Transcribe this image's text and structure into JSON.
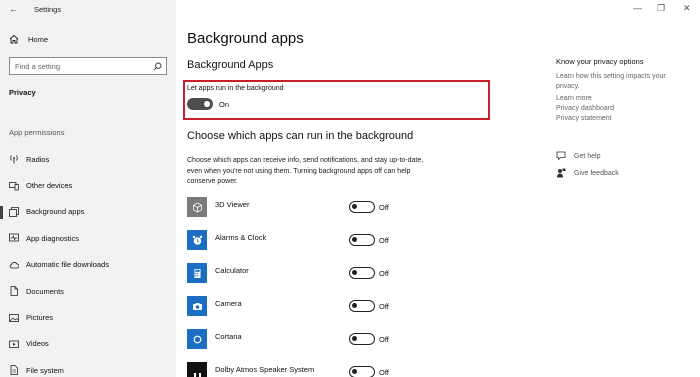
{
  "window": {
    "title": "Settings",
    "back_glyph": "←",
    "minimize_glyph": "—",
    "maximize_glyph": "❐",
    "close_glyph": "✕"
  },
  "sidebar": {
    "home_label": "Home",
    "search_placeholder": "Find a setting",
    "section_label": "Privacy",
    "permissions_heading": "App permissions",
    "items": [
      {
        "label": "Radios",
        "icon": "radio-icon"
      },
      {
        "label": "Other devices",
        "icon": "devices-icon"
      },
      {
        "label": "Background apps",
        "icon": "background-apps-icon",
        "active": true
      },
      {
        "label": "App diagnostics",
        "icon": "diagnostics-icon"
      },
      {
        "label": "Automatic file downloads",
        "icon": "cloud-icon"
      },
      {
        "label": "Documents",
        "icon": "document-icon"
      },
      {
        "label": "Pictures",
        "icon": "picture-icon"
      },
      {
        "label": "Videos",
        "icon": "video-icon"
      },
      {
        "label": "File system",
        "icon": "file-system-icon"
      }
    ]
  },
  "main": {
    "title": "Background apps",
    "subtitle": "Background Apps",
    "master_toggle_label": "Let apps run in the background",
    "master_toggle_state": "On",
    "choose_heading": "Choose which apps can run in the background",
    "description": "Choose which apps can receive info, send notifications, and stay up-to-date, even when you're not using them. Turning background apps off can help conserve power.",
    "apps": [
      {
        "name": "3D Viewer",
        "state": "Off",
        "icon": "cube-icon",
        "color": "#7a7a7a"
      },
      {
        "name": "Alarms & Clock",
        "state": "Off",
        "icon": "clock-icon",
        "color": "#1b6ec2"
      },
      {
        "name": "Calculator",
        "state": "Off",
        "icon": "calculator-icon",
        "color": "#1b6ec2"
      },
      {
        "name": "Camera",
        "state": "Off",
        "icon": "camera-icon",
        "color": "#1b6ec2"
      },
      {
        "name": "Cortana",
        "state": "Off",
        "icon": "cortana-icon",
        "color": "#1b6ec2"
      },
      {
        "name": "Dolby Atmos Speaker System",
        "state": "Off",
        "icon": "dolby-icon",
        "color": "#111111"
      }
    ]
  },
  "right_panel": {
    "title": "Know your privacy options",
    "text": "Learn how this setting impacts your privacy.",
    "links": [
      "Learn more",
      "Privacy dashboard",
      "Privacy statement"
    ],
    "get_help": "Get help",
    "give_feedback": "Give feedback"
  },
  "colors": {
    "highlight_border": "#c8202a",
    "sidebar_bg": "#f2f2f2",
    "accent_blue": "#1b6ec2"
  }
}
